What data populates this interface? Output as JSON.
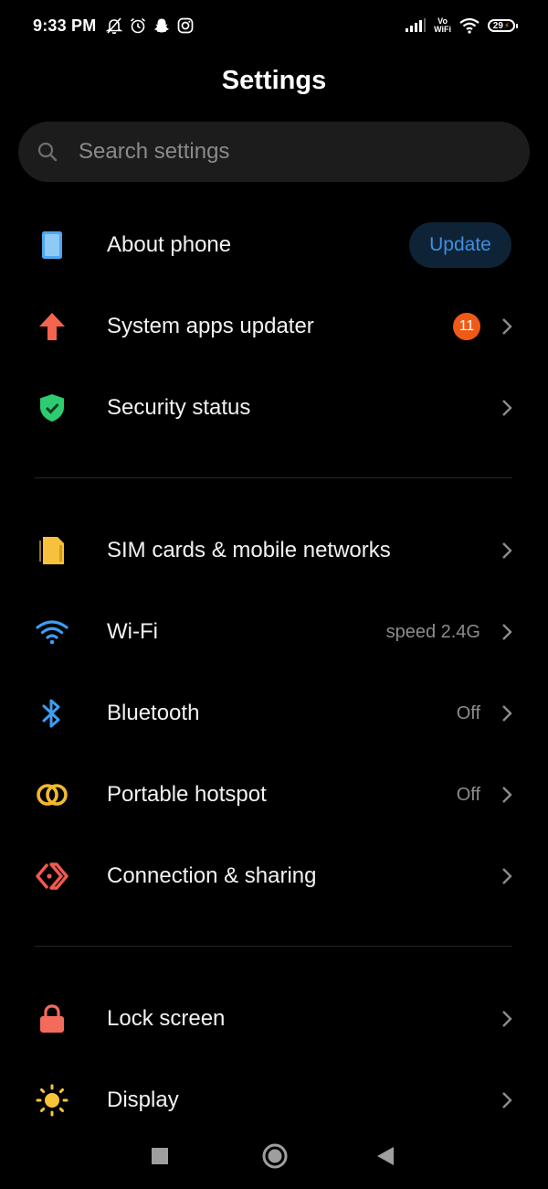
{
  "status_bar": {
    "time": "9:33 PM",
    "volte_top": "Vo",
    "volte_bottom": "WiFi",
    "battery": "29"
  },
  "header": {
    "title": "Settings"
  },
  "search": {
    "placeholder": "Search settings"
  },
  "groups": {
    "about": {
      "label": "About phone",
      "button": "Update",
      "icon": "phone-icon"
    },
    "updater": {
      "label": "System apps updater",
      "badge": "11",
      "icon": "arrow-up-icon"
    },
    "security": {
      "label": "Security status",
      "icon": "shield-check-icon"
    },
    "sim": {
      "label": "SIM cards & mobile networks",
      "icon": "sim-card-icon"
    },
    "wifi": {
      "label": "Wi-Fi",
      "value": "speed 2.4G",
      "icon": "wifi-icon"
    },
    "bluetooth": {
      "label": "Bluetooth",
      "value": "Off",
      "icon": "bluetooth-icon"
    },
    "hotspot": {
      "label": "Portable hotspot",
      "value": "Off",
      "icon": "hotspot-icon"
    },
    "connection": {
      "label": "Connection & sharing",
      "icon": "connection-sharing-icon"
    },
    "lock": {
      "label": "Lock screen",
      "icon": "lock-icon"
    },
    "display": {
      "label": "Display",
      "icon": "sun-icon"
    }
  },
  "colors": {
    "background": "#000000",
    "accent_blue": "#3d8fe0",
    "badge_orange": "#f05a16",
    "icon_phone": "#4ea6ef",
    "icon_updater": "#f4644f",
    "icon_security": "#2ecc71",
    "icon_sim": "#f7c13b",
    "icon_wifi": "#3d9df2",
    "icon_bluetooth": "#3d9df2",
    "icon_hotspot": "#f2b92e",
    "icon_connection": "#f05a4f",
    "icon_lock": "#f26b5b",
    "icon_display": "#f7c53a"
  },
  "nav_bar": {
    "recents": "square-icon",
    "home": "circle-icon",
    "back": "triangle-back-icon"
  }
}
